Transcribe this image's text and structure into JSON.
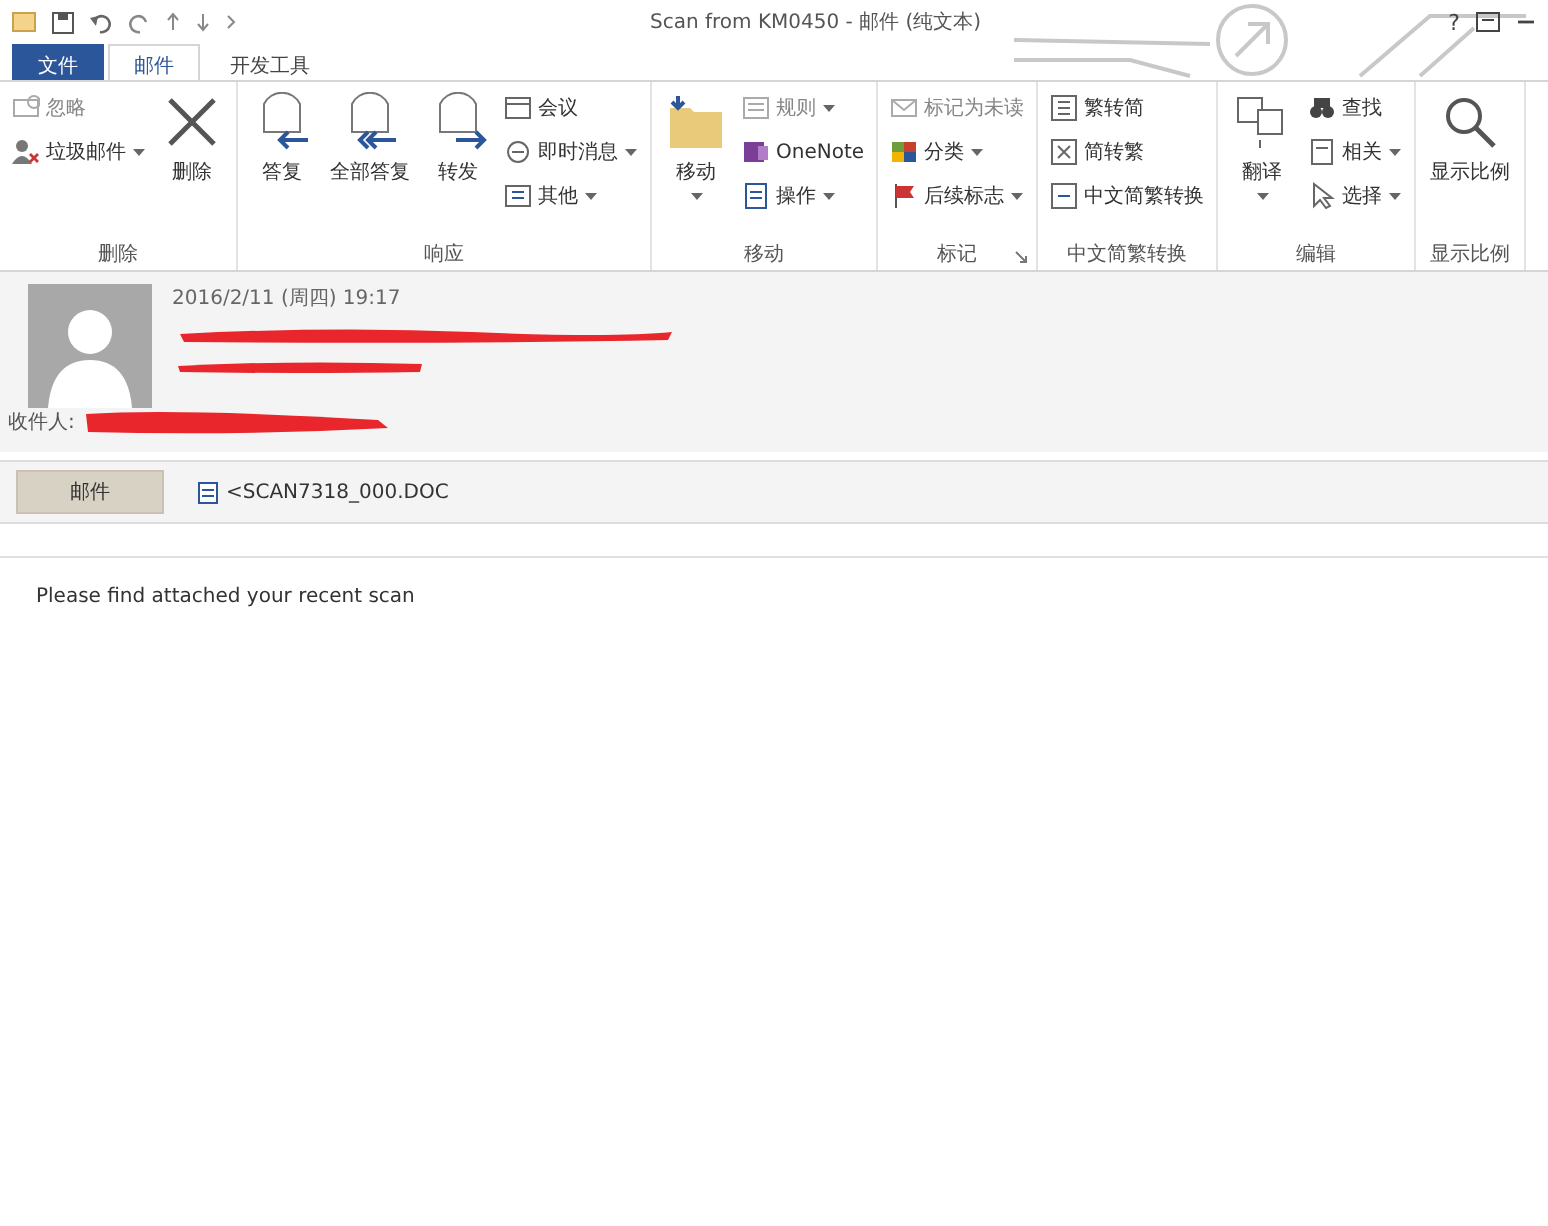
{
  "title_bar": {
    "title": "Scan from KM0450 - 邮件 (纯文本)",
    "help": "?"
  },
  "tabs": [
    {
      "label": "文件",
      "kind": "file",
      "selected": false
    },
    {
      "label": "邮件",
      "kind": "tab",
      "selected": true
    },
    {
      "label": "开发工具",
      "kind": "tab",
      "selected": false
    }
  ],
  "ribbon": {
    "groups": [
      {
        "label": "删除",
        "launcher": false,
        "items": [
          {
            "label": "忽略",
            "kind": "small",
            "disabled": true,
            "dropdown": false
          },
          {
            "label": "垃圾邮件",
            "kind": "small",
            "disabled": false,
            "dropdown": true
          },
          {
            "label": "删除",
            "kind": "large",
            "disabled": false,
            "dropdown": false
          }
        ]
      },
      {
        "label": "响应",
        "launcher": false,
        "items": [
          {
            "label": "答复",
            "kind": "large",
            "disabled": false,
            "dropdown": false
          },
          {
            "label": "全部答复",
            "kind": "large",
            "disabled": false,
            "dropdown": false
          },
          {
            "label": "转发",
            "kind": "large",
            "disabled": false,
            "dropdown": false
          },
          {
            "label": "会议",
            "kind": "small",
            "disabled": false,
            "dropdown": false
          },
          {
            "label": "即时消息",
            "kind": "small",
            "disabled": false,
            "dropdown": true
          },
          {
            "label": "其他",
            "kind": "small",
            "disabled": false,
            "dropdown": true
          }
        ]
      },
      {
        "label": "移动",
        "launcher": false,
        "items": [
          {
            "label": "移动",
            "kind": "large",
            "disabled": false,
            "dropdown": true
          },
          {
            "label": "规则",
            "kind": "small",
            "disabled": true,
            "dropdown": true
          },
          {
            "label": "OneNote",
            "kind": "small",
            "disabled": false,
            "dropdown": false
          },
          {
            "label": "操作",
            "kind": "small",
            "disabled": false,
            "dropdown": true
          }
        ]
      },
      {
        "label": "标记",
        "launcher": true,
        "items": [
          {
            "label": "标记为未读",
            "kind": "small",
            "disabled": true,
            "dropdown": false
          },
          {
            "label": "分类",
            "kind": "small",
            "disabled": false,
            "dropdown": true
          },
          {
            "label": "后续标志",
            "kind": "small",
            "disabled": false,
            "dropdown": true
          }
        ]
      },
      {
        "label": "中文简繁转换",
        "launcher": false,
        "items": [
          {
            "label": "繁转简",
            "kind": "small",
            "disabled": false,
            "dropdown": false
          },
          {
            "label": "简转繁",
            "kind": "small",
            "disabled": false,
            "dropdown": false
          },
          {
            "label": "中文简繁转换",
            "kind": "small",
            "disabled": false,
            "dropdown": false
          }
        ]
      },
      {
        "label": "编辑",
        "launcher": false,
        "items": [
          {
            "label": "翻译",
            "kind": "large",
            "disabled": false,
            "dropdown": true
          },
          {
            "label": "查找",
            "kind": "small",
            "disabled": false,
            "dropdown": false
          },
          {
            "label": "相关",
            "kind": "small",
            "disabled": false,
            "dropdown": true
          },
          {
            "label": "选择",
            "kind": "small",
            "disabled": false,
            "dropdown": true
          }
        ]
      },
      {
        "label": "显示比例",
        "launcher": false,
        "items": [
          {
            "label": "显示比例",
            "kind": "large",
            "disabled": false,
            "dropdown": false
          }
        ]
      }
    ]
  },
  "message": {
    "date": "2016/2/11 (周四) 19:17",
    "to_label": "收件人:"
  },
  "attachments": [
    {
      "label": "邮件",
      "kind": "message",
      "selected": true
    },
    {
      "label": "<SCAN7318_000.DOC",
      "kind": "file",
      "selected": false
    }
  ],
  "body": {
    "text": "Please find attached your recent scan"
  }
}
